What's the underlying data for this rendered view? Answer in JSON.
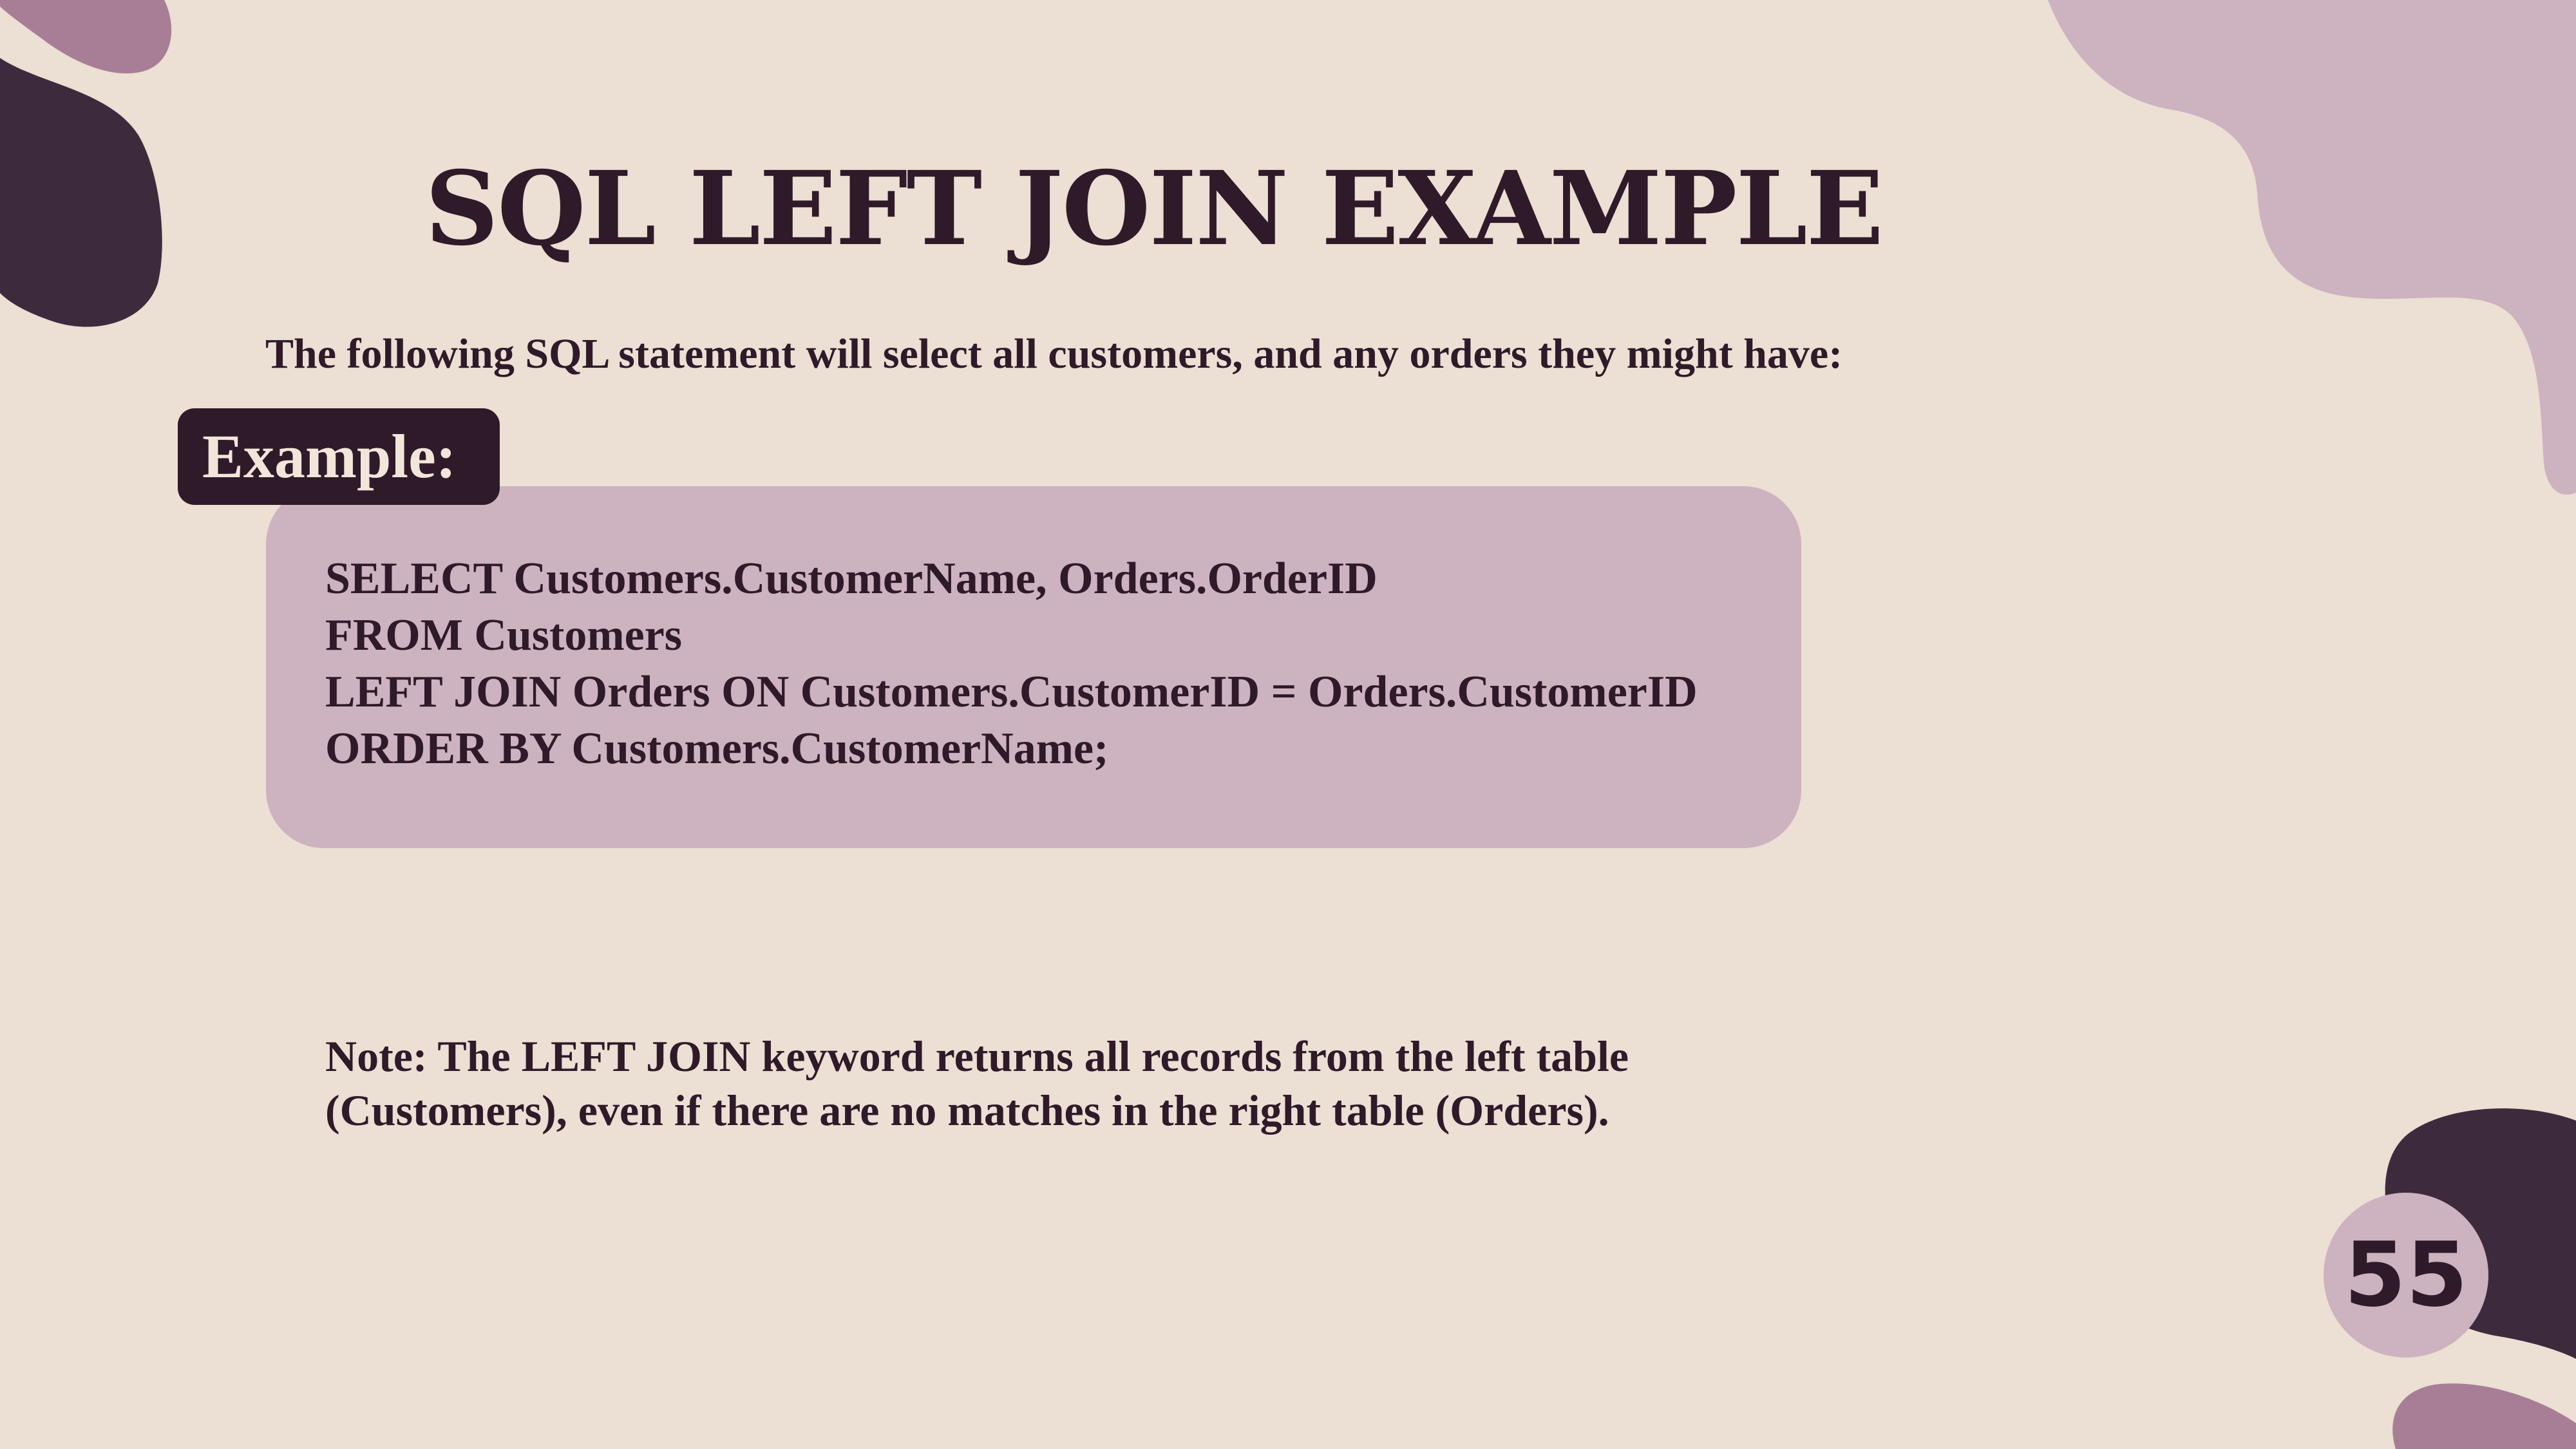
{
  "slide": {
    "title": "SQL LEFT JOIN EXAMPLE",
    "intro": "The following SQL statement will select all customers, and any orders they might have:",
    "example_label": "Example:",
    "code_lines": [
      "SELECT Customers.CustomerName, Orders.OrderID",
      "FROM Customers",
      "LEFT JOIN Orders ON Customers.CustomerID = Orders.CustomerID",
      "ORDER BY Customers.CustomerName;"
    ],
    "note_lines": [
      "Note: The LEFT JOIN keyword returns all records from the left table",
      "(Customers), even if there are no matches in the right table (Orders)."
    ],
    "page_number": "55"
  },
  "colors": {
    "background": "#ecdfd3",
    "dark_plum": "#3d2b3d",
    "mauve": "#a87e96",
    "light_mauve": "#cdb2c0",
    "text": "#2f1a2a"
  }
}
